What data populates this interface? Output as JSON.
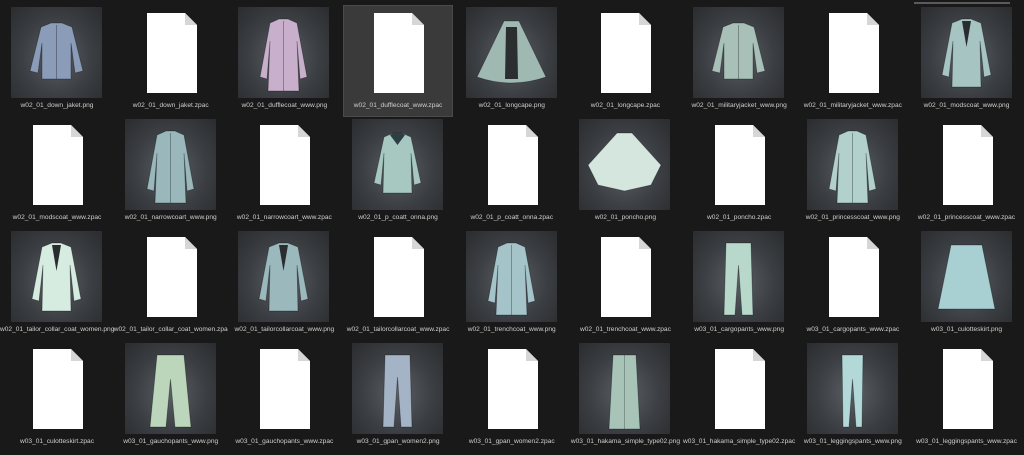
{
  "selected_index": 3,
  "files": [
    {
      "name": "w02_01_down_jaket.png",
      "type": "png",
      "garment": "jacket",
      "color": "#8b9cb8"
    },
    {
      "name": "w02_01_down_jaket.zpac",
      "type": "zpac"
    },
    {
      "name": "w02_01_dufflecoat_www.png",
      "type": "png",
      "garment": "longcoat",
      "color": "#c8b0cc"
    },
    {
      "name": "w02_01_dufflecoat_www.zpac",
      "type": "zpac"
    },
    {
      "name": "w02_01_longcape.png",
      "type": "png",
      "garment": "cape",
      "color": "#9fb8b2"
    },
    {
      "name": "w02_01_longcape.zpac",
      "type": "zpac"
    },
    {
      "name": "w02_01_militaryjacket_www.png",
      "type": "png",
      "garment": "jacket",
      "color": "#a9c0b9"
    },
    {
      "name": "w02_01_militaryjacket_www.zpac",
      "type": "zpac"
    },
    {
      "name": "w02_01_modscoat_www.png",
      "type": "png",
      "garment": "opencoat",
      "color": "#a6c4c2"
    },
    {
      "name": "w02_01_modscoat_www.zpac",
      "type": "zpac"
    },
    {
      "name": "w02_01_narrowcoart_www.png",
      "type": "png",
      "garment": "longcoat",
      "color": "#9ab8bb"
    },
    {
      "name": "w02_01_narrowcoart_www.zpac",
      "type": "zpac"
    },
    {
      "name": "w02_01_p_coatt_onna.png",
      "type": "png",
      "garment": "peacoat",
      "color": "#a7c8c1"
    },
    {
      "name": "w02_01_p_coatt_onna.zpac",
      "type": "zpac"
    },
    {
      "name": "w02_01_poncho.png",
      "type": "png",
      "garment": "poncho",
      "color": "#d4e6de"
    },
    {
      "name": "w02_01_poncho.zpac",
      "type": "zpac"
    },
    {
      "name": "w02_01_princesscoat_www.png",
      "type": "png",
      "garment": "longcoat",
      "color": "#b2d0cc"
    },
    {
      "name": "w02_01_princesscoat_www.zpac",
      "type": "zpac"
    },
    {
      "name": "w02_01_tailor_collar_coat_women.png",
      "type": "png",
      "garment": "opencoat",
      "color": "#d6ece0"
    },
    {
      "name": "w02_01_tailor_collar_coat_women.zpac",
      "type": "zpac"
    },
    {
      "name": "w02_01_tailorcollarcoat_www.png",
      "type": "png",
      "garment": "opencoat",
      "color": "#9bb8bc"
    },
    {
      "name": "w02_01_tailorcollarcoat_www.zpac",
      "type": "zpac"
    },
    {
      "name": "w02_01_trenchcoat_www.png",
      "type": "png",
      "garment": "longcoat",
      "color": "#a5c4ca"
    },
    {
      "name": "w02_01_trenchcoat_www.zpac",
      "type": "zpac"
    },
    {
      "name": "w03_01_cargopants_www.png",
      "type": "png",
      "garment": "pants",
      "color": "#b8d8cc"
    },
    {
      "name": "w03_01_cargopants_www.zpac",
      "type": "zpac"
    },
    {
      "name": "w03_01_culotteskirt.png",
      "type": "png",
      "garment": "skirt",
      "color": "#a8d0d2"
    },
    {
      "name": "w03_01_culotteskirt.zpac",
      "type": "zpac"
    },
    {
      "name": "w03_01_gauchopants_www.png",
      "type": "png",
      "garment": "widepants",
      "color": "#bcd6bc"
    },
    {
      "name": "w03_01_gauchopants_www.zpac",
      "type": "zpac"
    },
    {
      "name": "w03_01_gpan_women2.png",
      "type": "png",
      "garment": "pants",
      "color": "#a4b4c6"
    },
    {
      "name": "w03_01_gpan_women2.zpac",
      "type": "zpac"
    },
    {
      "name": "w03_01_hakama_simple_type02.png",
      "type": "png",
      "garment": "hakama",
      "color": "#a8c4b8"
    },
    {
      "name": "w03_01_hakama_simple_type02.zpac",
      "type": "zpac"
    },
    {
      "name": "w03_01_leggingspants_www.png",
      "type": "png",
      "garment": "leggings",
      "color": "#b2d8d8"
    },
    {
      "name": "w03_01_leggingspants_www.zpac",
      "type": "zpac"
    }
  ]
}
